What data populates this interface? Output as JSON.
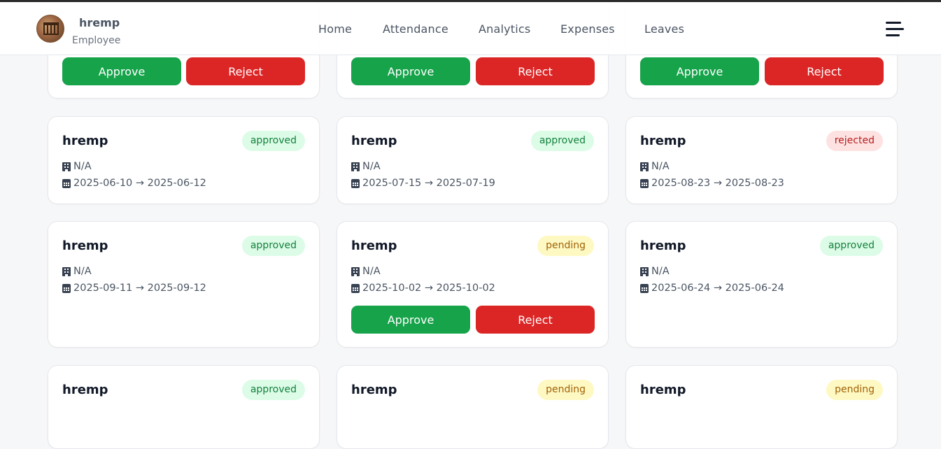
{
  "header": {
    "user_name": "hremp",
    "user_role": "Employee",
    "nav": [
      "Home",
      "Attendance",
      "Analytics",
      "Expenses",
      "Leaves"
    ]
  },
  "actions": {
    "approve": "Approve",
    "reject": "Reject"
  },
  "cards": [
    {
      "name": "hremp",
      "status": "approved",
      "location": "N/A",
      "dates": "2025-06-10 → 2025-06-12"
    },
    {
      "name": "hremp",
      "status": "approved",
      "location": "N/A",
      "dates": "2025-07-15 → 2025-07-19"
    },
    {
      "name": "hremp",
      "status": "rejected",
      "location": "N/A",
      "dates": "2025-08-23 → 2025-08-23"
    },
    {
      "name": "hremp",
      "status": "approved",
      "location": "N/A",
      "dates": "2025-09-11 → 2025-09-12"
    },
    {
      "name": "hremp",
      "status": "pending",
      "location": "N/A",
      "dates": "2025-10-02 → 2025-10-02"
    },
    {
      "name": "hremp",
      "status": "approved",
      "location": "N/A",
      "dates": "2025-06-24 → 2025-06-24"
    },
    {
      "name": "hremp",
      "status": "approved"
    },
    {
      "name": "hremp",
      "status": "pending"
    },
    {
      "name": "hremp",
      "status": "pending"
    }
  ]
}
